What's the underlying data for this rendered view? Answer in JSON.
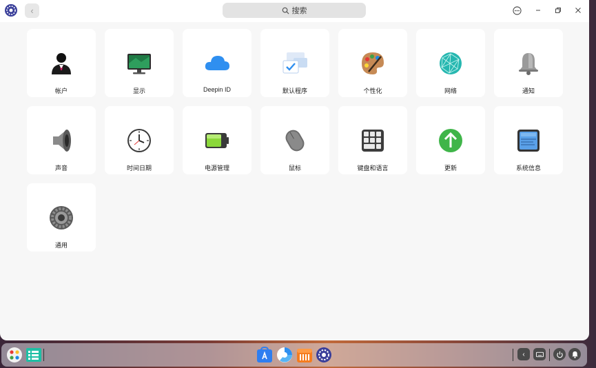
{
  "titlebar": {
    "search_placeholder": "搜索",
    "back_icon": "chevron-left-icon",
    "menu_icon": "more-options-icon",
    "minimize_icon": "minimize-icon",
    "restore_icon": "restore-icon",
    "close_icon": "close-icon"
  },
  "modules": [
    {
      "label": "帐户",
      "icon": "account-icon"
    },
    {
      "label": "显示",
      "icon": "display-icon"
    },
    {
      "label": "Deepin ID",
      "icon": "cloud-icon"
    },
    {
      "label": "默认程序",
      "icon": "default-apps-icon"
    },
    {
      "label": "个性化",
      "icon": "personalization-icon"
    },
    {
      "label": "网络",
      "icon": "network-icon"
    },
    {
      "label": "通知",
      "icon": "bell-icon"
    },
    {
      "label": "声音",
      "icon": "speaker-icon"
    },
    {
      "label": "时间日期",
      "icon": "clock-icon"
    },
    {
      "label": "电源管理",
      "icon": "battery-icon"
    },
    {
      "label": "鼠标",
      "icon": "mouse-icon"
    },
    {
      "label": "键盘和语言",
      "icon": "keyboard-icon"
    },
    {
      "label": "更新",
      "icon": "update-icon"
    },
    {
      "label": "系统信息",
      "icon": "system-info-icon"
    },
    {
      "label": "通用",
      "icon": "gear-icon"
    }
  ],
  "dock": {
    "left_items": [
      "launcher-icon",
      "file-manager-icon"
    ],
    "center_items": [
      "app-store-icon",
      "browser-icon",
      "music-icon",
      "control-center-icon"
    ],
    "tray_items": [
      "collapse-tray-icon",
      "keyboard-tray-icon",
      "power-icon",
      "notification-icon"
    ]
  },
  "colors": {
    "window_bg": "#f7f7f7",
    "card_bg": "#ffffff",
    "accent_green": "#3fb549",
    "accent_blue": "#2f8ff0"
  }
}
